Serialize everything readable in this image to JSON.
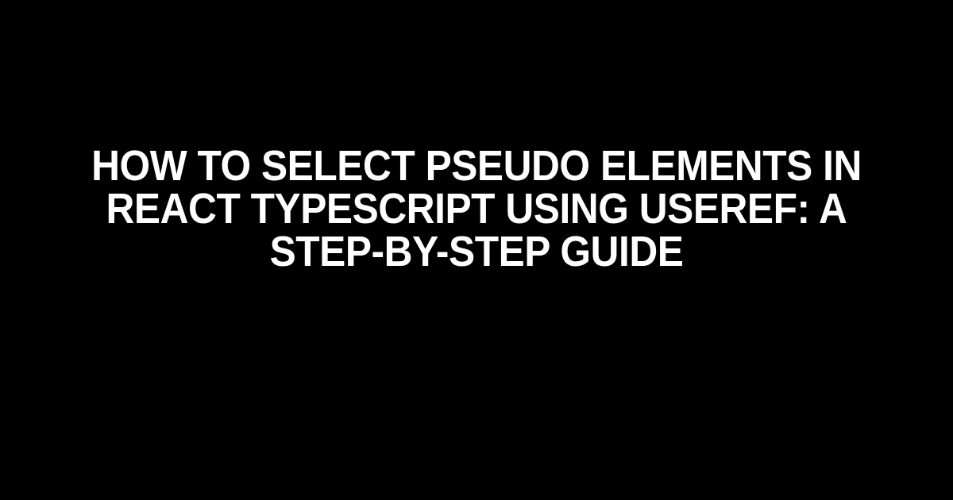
{
  "title": "How to Select Pseudo Elements in React TypeScript using useRef: A Step-by-Step Guide"
}
